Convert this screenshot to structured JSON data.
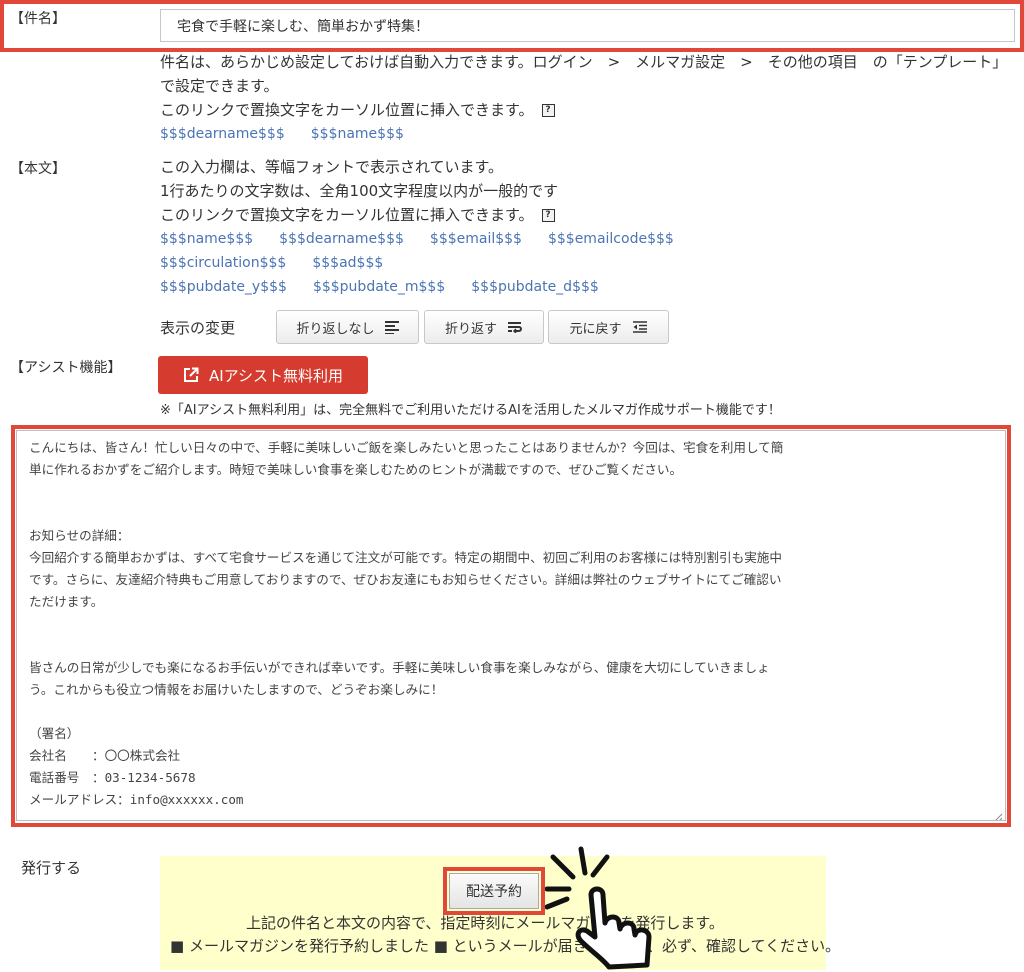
{
  "subject": {
    "label": "【件名】",
    "value": "宅食で手軽に楽しむ、簡単おかず特集！",
    "help": [
      "件名は、あらかじめ設定しておけば自動入力できます。ログイン　>　メルマガ設定　>　その他の項目　の「テンプレート」",
      "で設定できます。",
      "このリンクで置換文字をカーソル位置に挿入できます。"
    ],
    "tokens": [
      "$$$dearname$$$",
      "$$$name$$$"
    ]
  },
  "body": {
    "label": "【本文】",
    "help": [
      "この入力欄は、等幅フォントで表示されています。",
      "1行あたりの文字数は、全角100文字程度以内が一般的です",
      "このリンクで置換文字をカーソル位置に挿入できます。"
    ],
    "tokens_row1": [
      "$$$name$$$",
      "$$$dearname$$$",
      "$$$email$$$",
      "$$$emailcode$$$"
    ],
    "tokens_row2": [
      "$$$circulation$$$",
      "$$$ad$$$"
    ],
    "tokens_row3": [
      "$$$pubdate_y$$$",
      "$$$pubdate_m$$$",
      "$$$pubdate_d$$$"
    ],
    "display_change_label": "表示の変更",
    "buttons": {
      "nowrap": "折り返しなし",
      "wrap": "折り返す",
      "reset": "元に戻す"
    },
    "text_lines": [
      "こんにちは、皆さん！忙しい日々の中で、手軽に美味しいご飯を楽しみたいと思ったことはありませんか？今回は、宅食を利用して簡",
      "単に作れるおかずをご紹介します。時短で美味しい食事を楽しむためのヒントが満載ですので、ぜひご覧ください。",
      "",
      "",
      "お知らせの詳細：",
      "今回紹介する簡単おかずは、すべて宅食サービスを通じて注文が可能です。特定の期間中、初回ご利用のお客様には特別割引も実施中",
      "です。さらに、友達紹介特典もご用意しておりますので、ぜひお友達にもお知らせください。詳細は弊社のウェブサイトにてご確認い",
      "ただけます。",
      "",
      "",
      "皆さんの日常が少しでも楽になるお手伝いができれば幸いです。手軽に美味しい食事を楽しみながら、健康を大切にしていきましょ",
      "う。これからも役立つ情報をお届けいたしますので、どうぞお楽しみに！",
      "",
      "（署名）",
      "会社名　　：〇〇株式会社",
      "電話番号　：03-1234-5678",
      "メールアドレス：info@xxxxxx.com"
    ]
  },
  "assist": {
    "label": "【アシスト機能】",
    "button": "AIアシスト無料利用",
    "note": "※「AIアシスト無料利用」は、完全無料でご利用いただけるAIを活用したメルマガ作成サポート機能です！"
  },
  "publish": {
    "label": "発行する",
    "button": "配送予約",
    "line1": "上記の件名と本文の内容で、指定時刻にメールマガジンを発行します。",
    "line2": "■ メールマガジンを発行予約しました ■ というメールが届きますので、必ず、確認してください。"
  },
  "colors": {
    "highlight": "#e0483a",
    "link": "#4a74b5",
    "ai_button": "#d63b2f",
    "publish_bg": "#ffffcc"
  },
  "icons": [
    "question-icon",
    "external-link-icon",
    "nowrap-icon",
    "wrap-icon",
    "outdent-icon",
    "resize-grip-icon",
    "pointer-hand-icon"
  ]
}
